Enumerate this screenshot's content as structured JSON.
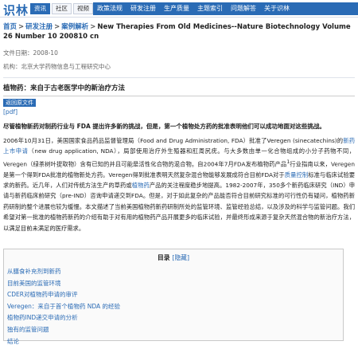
{
  "logo": "识林",
  "search_tabs": [
    "资讯",
    "社区",
    "视频"
  ],
  "nav": [
    "政策法规",
    "研发注册",
    "生产质量",
    "主题索引",
    "问题解答",
    "关于识林"
  ],
  "breadcrumb": {
    "home": "首页",
    "lib": "研发注册",
    "cat": "案例解析",
    "current": "New Therapies From Old Medicines--Nature Biotechnology Volume 26 Number 10 200810 cn",
    "sep": ">"
  },
  "meta": {
    "date": "文件日期：2008-10",
    "org": "机构：北京大学药物信息与工程研究中心"
  },
  "article_title": "植物药：来自于古老医学中的新治疗方法",
  "back_button": "返回原文件",
  "pdf": "[pdf]",
  "lead": "尽管植物新药对制药行业与 FDA 提出许多新的挑战，但是，第一个植物处方药的批准表明他们可以成功地面对这些挑战。",
  "body": {
    "p1a": "2006年10月31日，美国国家食品药品监督管理局（Food and Drug Administration, FDA）批准了Veregen (sinecatechins)的",
    "p1_link": "新药上市申请",
    "p1b": "（new drug application, NDA），局部使用治疗外生殖器和肛周尻疣。与大多数由单一化合物组成的小分子药物不同，Veregen（绿茶树叶提取物）含有已知的并且可能是活性化合物的混合物。自2004年7月FDA发布植物药产品",
    "p1_sup": "1",
    "p1c": "行业指南以来，Veregen是第一个得到FDA批准的植物新处方药。Veregen得到批准表明天然复杂混合物能够发展成符合目前FDA对于",
    "p1_link2": "质量控制",
    "p1d": "标准与临床试验要求的新药。近几年，人们对传统方法生产的草药或",
    "p1_link3": "植物药",
    "p1e": "产品的关注程度稳步地提高。1982-2007年，350多个新药临床研究（IND）申请与新药临床前研究（pre-IND）咨询申请递交到FDA。但是，对于如此复杂的产品能否符合目前研究标准的可行性仍有疑问，植物药新药研制的整个进展也较为缓慢。本文描述了当前美国植物药新药研制所处的监管环境、监管经验总结，以及涉及的科学与监管问题。我们希望对第一批准的植物药新药的介绍有助于对有用的植物药产品开展更多的临床试验，并最终形成来源于复杂天然混合物的新治疗方法，以满足目前未满足的医疗需求。"
  },
  "toc": {
    "title": "目录",
    "hide": "[隐藏]",
    "items": [
      "从膳食补充剂到新药",
      "目前美国的监管环境",
      "CDER对植物药申请的审评",
      "Veregen：来自于首个植物药 NDA 的经验",
      "植物药IND递交申请的分析",
      "独有的监管问题",
      "结论"
    ]
  }
}
